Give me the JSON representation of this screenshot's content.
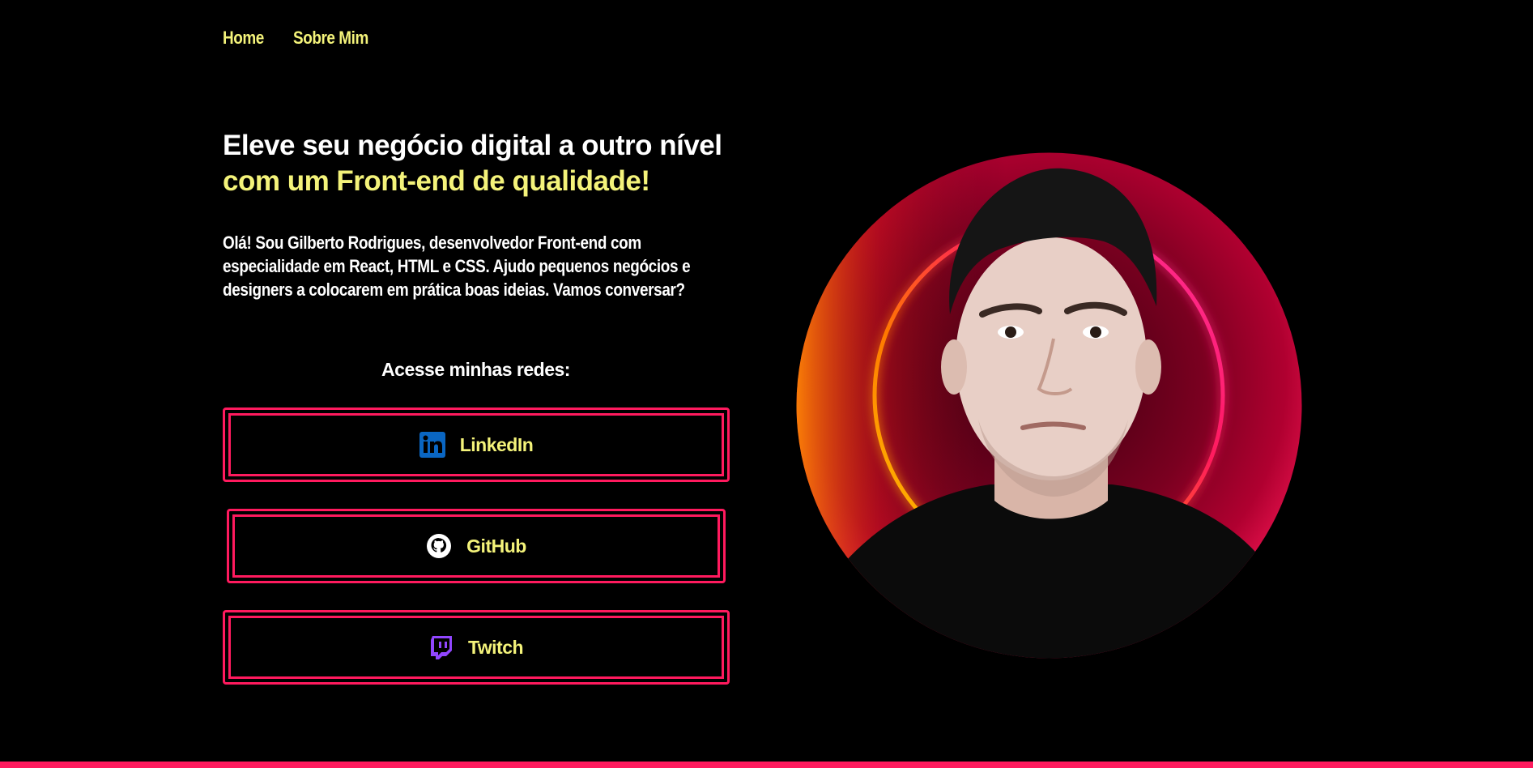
{
  "nav": {
    "items": [
      {
        "label": "Home"
      },
      {
        "label": "Sobre Mim"
      }
    ]
  },
  "hero": {
    "headline_line1": "Eleve seu negócio digital a outro nível",
    "headline_line2": "com um Front-end de qualidade!",
    "bio": "Olá! Sou Gilberto Rodrigues, desenvolvedor Front-end com especialidade em React, HTML e CSS. Ajudo pequenos negócios e designers a colocarem em prática boas ideias. Vamos conversar?"
  },
  "social": {
    "title": "Acesse minhas redes:",
    "buttons": [
      {
        "label": "LinkedIn",
        "icon": "linkedin-icon",
        "icon_color": "#0a66c2"
      },
      {
        "label": "GitHub",
        "icon": "github-icon",
        "icon_color": "#ffffff"
      },
      {
        "label": "Twitch",
        "icon": "twitch-icon",
        "icon_color": "#9146ff"
      }
    ]
  },
  "profile_photo": {
    "description_icon": "profile-photo"
  },
  "colors": {
    "background": "#000000",
    "accent_yellow": "#f4f37a",
    "accent_pink": "#ff1a5e",
    "text": "#ffffff"
  }
}
